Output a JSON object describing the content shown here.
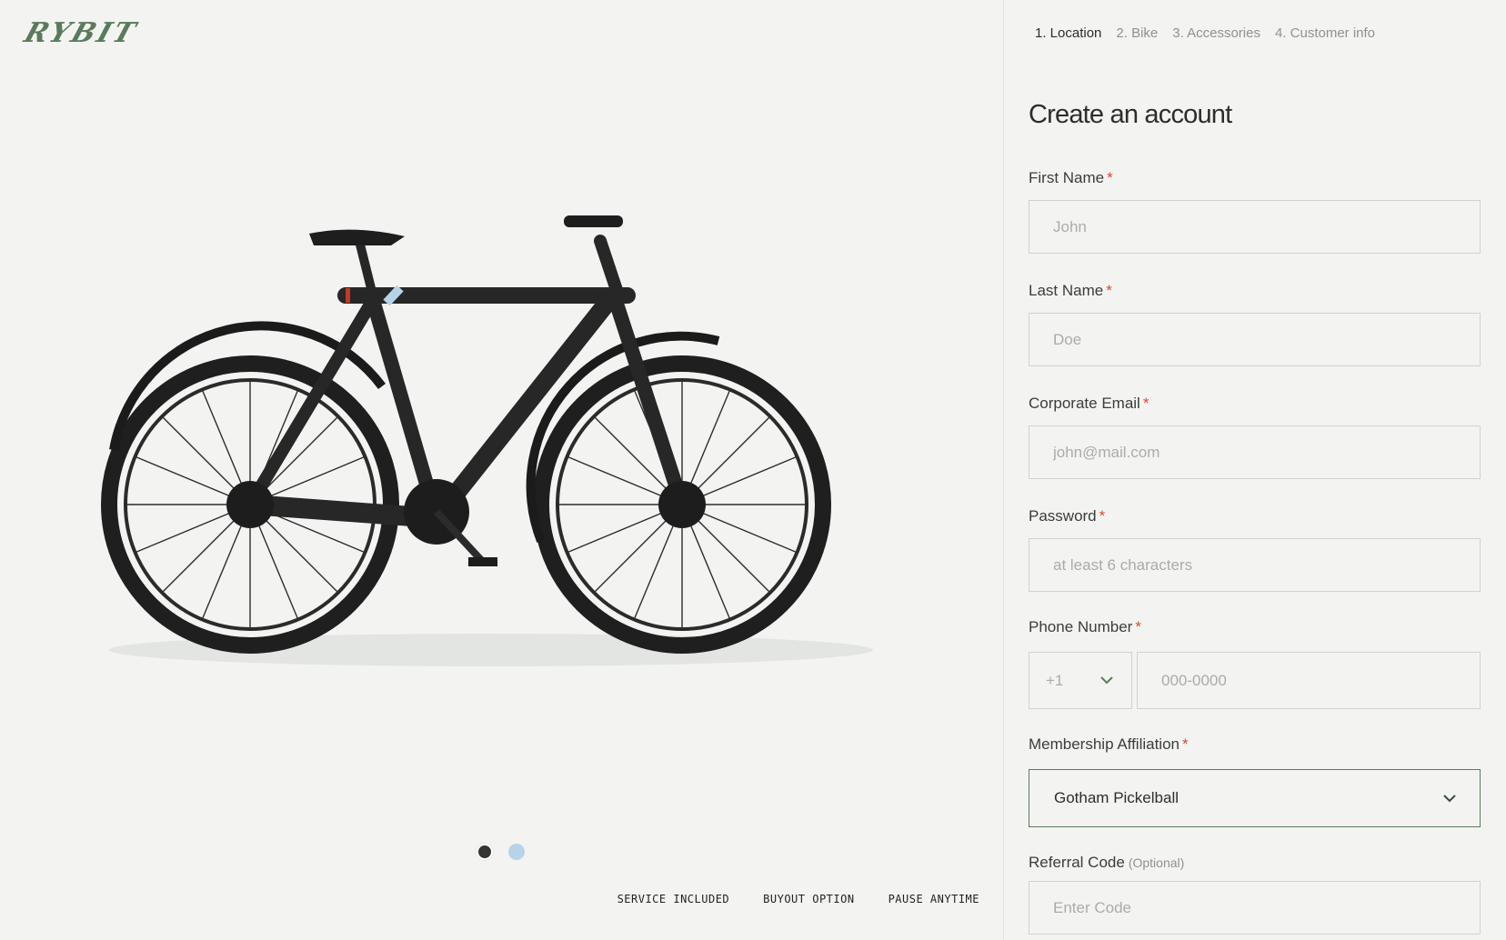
{
  "brand": {
    "name": "RYBIT",
    "color": "#5a7a5d"
  },
  "gallery": {
    "image": "black-ebike",
    "dots": [
      {
        "state": "active"
      },
      {
        "state": "inactive"
      }
    ]
  },
  "features": [
    "SERVICE INCLUDED",
    "BUYOUT OPTION",
    "PAUSE ANYTIME"
  ],
  "steps": [
    {
      "label": "1. Location",
      "active": true
    },
    {
      "label": "2. Bike",
      "active": false
    },
    {
      "label": "3. Accessories",
      "active": false
    },
    {
      "label": "4. Customer info",
      "active": false
    }
  ],
  "form": {
    "title": "Create an account",
    "first_name": {
      "label": "First Name",
      "required_mark": "*",
      "placeholder": "John",
      "value": ""
    },
    "last_name": {
      "label": "Last Name",
      "required_mark": "*",
      "placeholder": "Doe",
      "value": ""
    },
    "email": {
      "label": "Corporate Email",
      "required_mark": "*",
      "placeholder": "john@mail.com",
      "value": ""
    },
    "password": {
      "label": "Password",
      "required_mark": "*",
      "placeholder": "at least 6 characters",
      "value": ""
    },
    "phone": {
      "label": "Phone Number",
      "required_mark": "*",
      "country_code": "+1",
      "placeholder": "000-0000",
      "value": ""
    },
    "membership": {
      "label": "Membership Affiliation",
      "required_mark": "*",
      "selected": "Gotham Pickelball"
    },
    "referral": {
      "label": "Referral Code",
      "optional_note": "(Optional)",
      "placeholder": "Enter Code",
      "value": ""
    }
  },
  "colors": {
    "accent": "#5a7a5d",
    "required": "#e0482f",
    "background": "#f3f4f1"
  }
}
